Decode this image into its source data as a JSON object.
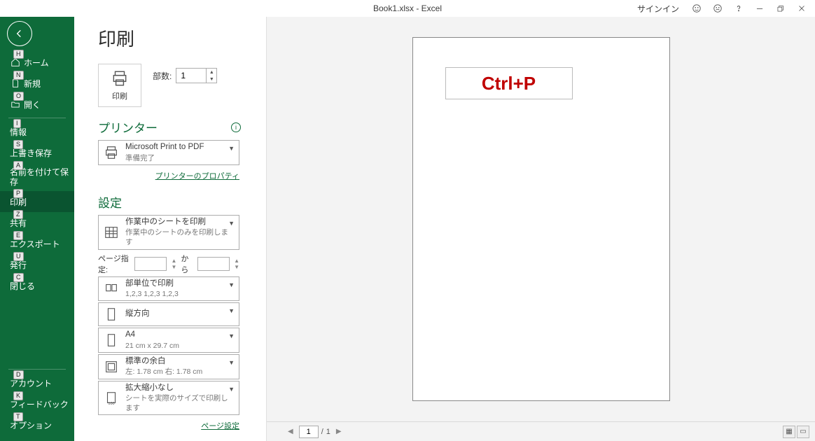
{
  "title": "Book1.xlsx  -  Excel",
  "signin": "サインイン",
  "sidebar": {
    "home": "ホーム",
    "new": "新規",
    "open": "開く",
    "info": "情報",
    "save": "上書き保存",
    "saveas": "名前を付けて保存",
    "print": "印刷",
    "share": "共有",
    "export": "エクスポート",
    "publish": "発行",
    "close": "閉じる",
    "account": "アカウント",
    "feedback": "フィードバック",
    "options": "オプション",
    "keys": {
      "home": "H",
      "new": "N",
      "open": "O",
      "info": "I",
      "save": "S",
      "saveas": "A",
      "print": "P",
      "share": "Z",
      "export": "E",
      "publish": "U",
      "close": "C",
      "account": "D",
      "feedback": "K",
      "options": "T"
    }
  },
  "page": {
    "title": "印刷",
    "print_label": "印刷",
    "copies_label": "部数:",
    "copies_value": "1",
    "printer_h": "プリンター",
    "printer_name": "Microsoft Print to PDF",
    "printer_status": "準備完了",
    "printer_props": "プリンターのプロパティ",
    "settings_h": "設定",
    "s_sheets_l1": "作業中のシートを印刷",
    "s_sheets_l2": "作業中のシートのみを印刷します",
    "pagespec_label": "ページ指定:",
    "pagespec_to": "から",
    "s_collate_l1": "部単位で印刷",
    "s_collate_l2": "1,2,3     1,2,3     1,2,3",
    "s_orient_l1": "縦方向",
    "s_paper_l1": "A4",
    "s_paper_l2": "21 cm x 29.7 cm",
    "s_margin_l1": "標準の余白",
    "s_margin_l2": "左:  1.78 cm    右:  1.78 cm",
    "s_scale_l1": "拡大縮小なし",
    "s_scale_l2": "シートを実際のサイズで印刷します",
    "page_setup": "ページ設定"
  },
  "preview": {
    "cell_text": "Ctrl+P",
    "page_input": "1",
    "page_sep": "/",
    "page_total": "1"
  }
}
